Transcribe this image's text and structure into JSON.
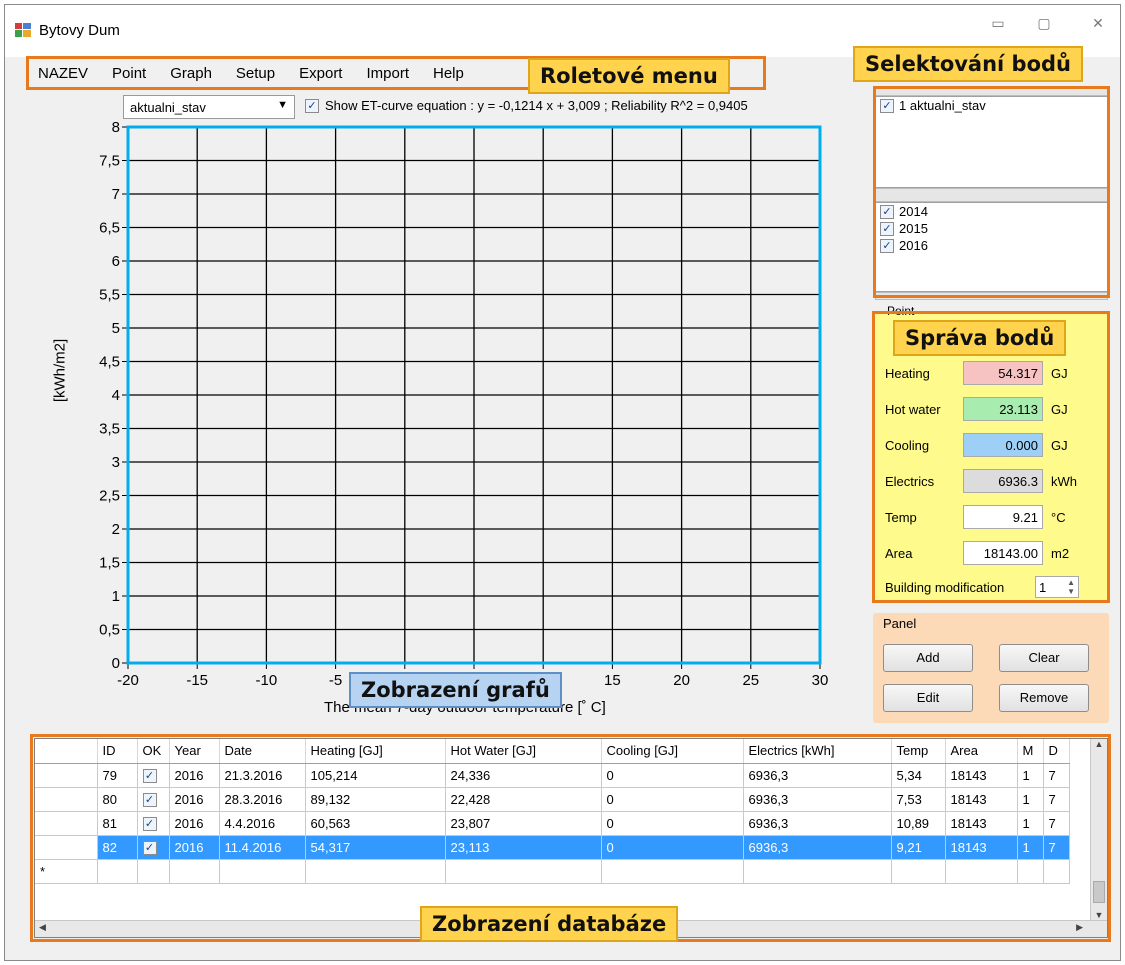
{
  "window": {
    "title": "Bytovy Dum",
    "controls": [
      "minimize-icon",
      "maximize-icon",
      "close-icon"
    ]
  },
  "menu": [
    "NAZEV",
    "Point",
    "Graph",
    "Setup",
    "Export",
    "Import",
    "Help"
  ],
  "callouts": {
    "menu": "Roletové menu",
    "selection": "Selektování bodů",
    "points": "Správa bodů",
    "graph": "Zobrazení grafů",
    "database": "Zobrazení databáze"
  },
  "graph_toolbar": {
    "dataset": "aktualni_stav",
    "equation_checkbox_checked": true,
    "equation_text": "Show ET-curve equation :  y = -0,1214 x + 3,009 ; Reliability R^2 = 0,9405"
  },
  "chart_data": {
    "type": "scatter",
    "xlabel": "The mean 7-day outdoor temperature [˚ C]",
    "ylabel": "[kWh/m2]",
    "xlim": [
      -20,
      30
    ],
    "ylim": [
      0,
      8
    ],
    "x_ticks": [
      "-20",
      "-15",
      "-10",
      "-5",
      "0",
      "5",
      "10",
      "15",
      "20",
      "25",
      "30"
    ],
    "y_ticks": [
      "0",
      "0,5",
      "1",
      "1,5",
      "2",
      "2,5",
      "3",
      "3,5",
      "4",
      "4,5",
      "5",
      "5,5",
      "6",
      "6,5",
      "7",
      "7,5",
      "8"
    ],
    "grid": true,
    "frame_color": "#00aeef",
    "series": []
  },
  "selection": {
    "datasets": [
      {
        "label": "1 aktualni_stav",
        "checked": true
      }
    ],
    "years": [
      {
        "label": "2014",
        "checked": true
      },
      {
        "label": "2015",
        "checked": true
      },
      {
        "label": "2016",
        "checked": true
      }
    ]
  },
  "point_props": {
    "group_title": "Point",
    "fields": [
      {
        "label": "Heating",
        "value": "54.317",
        "unit": "GJ",
        "color": "#f6c2c2"
      },
      {
        "label": "Hot water",
        "value": "23.113",
        "unit": "GJ",
        "color": "#a8ecb0"
      },
      {
        "label": "Cooling",
        "value": "0.000",
        "unit": "GJ",
        "color": "#9ed0f7"
      },
      {
        "label": "Electrics",
        "value": "6936.3",
        "unit": "kWh",
        "color": "#dcdcdc"
      },
      {
        "label": "Temp",
        "value": "9.21",
        "unit": "°C",
        "color": "#ffffff"
      },
      {
        "label": "Area",
        "value": "18143.00",
        "unit": "m2",
        "color": "#ffffff"
      }
    ],
    "building_mod_label": "Building modification",
    "building_mod_value": "1"
  },
  "panel": {
    "title": "Panel",
    "add": "Add",
    "clear": "Clear",
    "edit": "Edit",
    "remove": "Remove"
  },
  "table": {
    "columns": [
      "ID",
      "OK",
      "Year",
      "Date",
      "Heating [GJ]",
      "Hot Water [GJ]",
      "Cooling [GJ]",
      "Electrics [kWh]",
      "Temp",
      "Area",
      "M",
      "D"
    ],
    "rows": [
      {
        "id": "79",
        "ok": true,
        "year": "2016",
        "date": "21.3.2016",
        "heating": "105,214",
        "hotwater": "24,336",
        "cooling": "0",
        "electrics": "6936,3",
        "temp": "5,34",
        "area": "18143",
        "m": "1",
        "d": "7",
        "selected": false
      },
      {
        "id": "80",
        "ok": true,
        "year": "2016",
        "date": "28.3.2016",
        "heating": "89,132",
        "hotwater": "22,428",
        "cooling": "0",
        "electrics": "6936,3",
        "temp": "7,53",
        "area": "18143",
        "m": "1",
        "d": "7",
        "selected": false
      },
      {
        "id": "81",
        "ok": true,
        "year": "2016",
        "date": "4.4.2016",
        "heating": "60,563",
        "hotwater": "23,807",
        "cooling": "0",
        "electrics": "6936,3",
        "temp": "10,89",
        "area": "18143",
        "m": "1",
        "d": "7",
        "selected": false
      },
      {
        "id": "82",
        "ok": true,
        "year": "2016",
        "date": "11.4.2016",
        "heating": "54,317",
        "hotwater": "23,113",
        "cooling": "0",
        "electrics": "6936,3",
        "temp": "9,21",
        "area": "18143",
        "m": "1",
        "d": "7",
        "selected": true
      }
    ],
    "new_row_marker": "*",
    "current_row_marker": "▶"
  },
  "colors": {
    "callout_fill": "#ffd34d",
    "callout_blue": "#b7d3f2",
    "frame_orange": "#e8791d",
    "selection_blue": "#3399ff",
    "props_bg": "#fffa8c",
    "panel_bg": "#fcd9b7"
  }
}
